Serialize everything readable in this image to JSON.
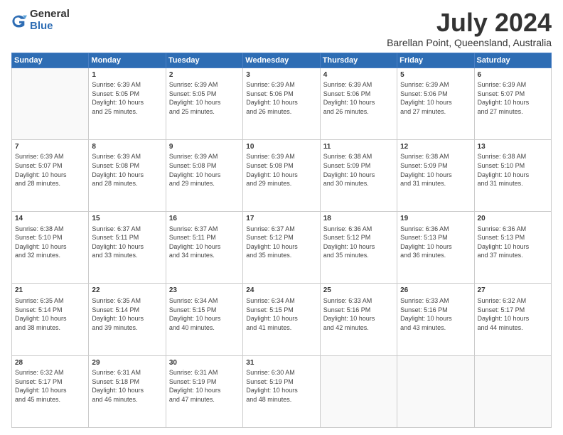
{
  "logo": {
    "general": "General",
    "blue": "Blue"
  },
  "title": "July 2024",
  "subtitle": "Barellan Point, Queensland, Australia",
  "days": [
    "Sunday",
    "Monday",
    "Tuesday",
    "Wednesday",
    "Thursday",
    "Friday",
    "Saturday"
  ],
  "weeks": [
    [
      {
        "day": "",
        "content": ""
      },
      {
        "day": "1",
        "content": "Sunrise: 6:39 AM\nSunset: 5:05 PM\nDaylight: 10 hours\nand 25 minutes."
      },
      {
        "day": "2",
        "content": "Sunrise: 6:39 AM\nSunset: 5:05 PM\nDaylight: 10 hours\nand 25 minutes."
      },
      {
        "day": "3",
        "content": "Sunrise: 6:39 AM\nSunset: 5:06 PM\nDaylight: 10 hours\nand 26 minutes."
      },
      {
        "day": "4",
        "content": "Sunrise: 6:39 AM\nSunset: 5:06 PM\nDaylight: 10 hours\nand 26 minutes."
      },
      {
        "day": "5",
        "content": "Sunrise: 6:39 AM\nSunset: 5:06 PM\nDaylight: 10 hours\nand 27 minutes."
      },
      {
        "day": "6",
        "content": "Sunrise: 6:39 AM\nSunset: 5:07 PM\nDaylight: 10 hours\nand 27 minutes."
      }
    ],
    [
      {
        "day": "7",
        "content": "Sunrise: 6:39 AM\nSunset: 5:07 PM\nDaylight: 10 hours\nand 28 minutes."
      },
      {
        "day": "8",
        "content": "Sunrise: 6:39 AM\nSunset: 5:08 PM\nDaylight: 10 hours\nand 28 minutes."
      },
      {
        "day": "9",
        "content": "Sunrise: 6:39 AM\nSunset: 5:08 PM\nDaylight: 10 hours\nand 29 minutes."
      },
      {
        "day": "10",
        "content": "Sunrise: 6:39 AM\nSunset: 5:08 PM\nDaylight: 10 hours\nand 29 minutes."
      },
      {
        "day": "11",
        "content": "Sunrise: 6:38 AM\nSunset: 5:09 PM\nDaylight: 10 hours\nand 30 minutes."
      },
      {
        "day": "12",
        "content": "Sunrise: 6:38 AM\nSunset: 5:09 PM\nDaylight: 10 hours\nand 31 minutes."
      },
      {
        "day": "13",
        "content": "Sunrise: 6:38 AM\nSunset: 5:10 PM\nDaylight: 10 hours\nand 31 minutes."
      }
    ],
    [
      {
        "day": "14",
        "content": "Sunrise: 6:38 AM\nSunset: 5:10 PM\nDaylight: 10 hours\nand 32 minutes."
      },
      {
        "day": "15",
        "content": "Sunrise: 6:37 AM\nSunset: 5:11 PM\nDaylight: 10 hours\nand 33 minutes."
      },
      {
        "day": "16",
        "content": "Sunrise: 6:37 AM\nSunset: 5:11 PM\nDaylight: 10 hours\nand 34 minutes."
      },
      {
        "day": "17",
        "content": "Sunrise: 6:37 AM\nSunset: 5:12 PM\nDaylight: 10 hours\nand 35 minutes."
      },
      {
        "day": "18",
        "content": "Sunrise: 6:36 AM\nSunset: 5:12 PM\nDaylight: 10 hours\nand 35 minutes."
      },
      {
        "day": "19",
        "content": "Sunrise: 6:36 AM\nSunset: 5:13 PM\nDaylight: 10 hours\nand 36 minutes."
      },
      {
        "day": "20",
        "content": "Sunrise: 6:36 AM\nSunset: 5:13 PM\nDaylight: 10 hours\nand 37 minutes."
      }
    ],
    [
      {
        "day": "21",
        "content": "Sunrise: 6:35 AM\nSunset: 5:14 PM\nDaylight: 10 hours\nand 38 minutes."
      },
      {
        "day": "22",
        "content": "Sunrise: 6:35 AM\nSunset: 5:14 PM\nDaylight: 10 hours\nand 39 minutes."
      },
      {
        "day": "23",
        "content": "Sunrise: 6:34 AM\nSunset: 5:15 PM\nDaylight: 10 hours\nand 40 minutes."
      },
      {
        "day": "24",
        "content": "Sunrise: 6:34 AM\nSunset: 5:15 PM\nDaylight: 10 hours\nand 41 minutes."
      },
      {
        "day": "25",
        "content": "Sunrise: 6:33 AM\nSunset: 5:16 PM\nDaylight: 10 hours\nand 42 minutes."
      },
      {
        "day": "26",
        "content": "Sunrise: 6:33 AM\nSunset: 5:16 PM\nDaylight: 10 hours\nand 43 minutes."
      },
      {
        "day": "27",
        "content": "Sunrise: 6:32 AM\nSunset: 5:17 PM\nDaylight: 10 hours\nand 44 minutes."
      }
    ],
    [
      {
        "day": "28",
        "content": "Sunrise: 6:32 AM\nSunset: 5:17 PM\nDaylight: 10 hours\nand 45 minutes."
      },
      {
        "day": "29",
        "content": "Sunrise: 6:31 AM\nSunset: 5:18 PM\nDaylight: 10 hours\nand 46 minutes."
      },
      {
        "day": "30",
        "content": "Sunrise: 6:31 AM\nSunset: 5:19 PM\nDaylight: 10 hours\nand 47 minutes."
      },
      {
        "day": "31",
        "content": "Sunrise: 6:30 AM\nSunset: 5:19 PM\nDaylight: 10 hours\nand 48 minutes."
      },
      {
        "day": "",
        "content": ""
      },
      {
        "day": "",
        "content": ""
      },
      {
        "day": "",
        "content": ""
      }
    ]
  ]
}
